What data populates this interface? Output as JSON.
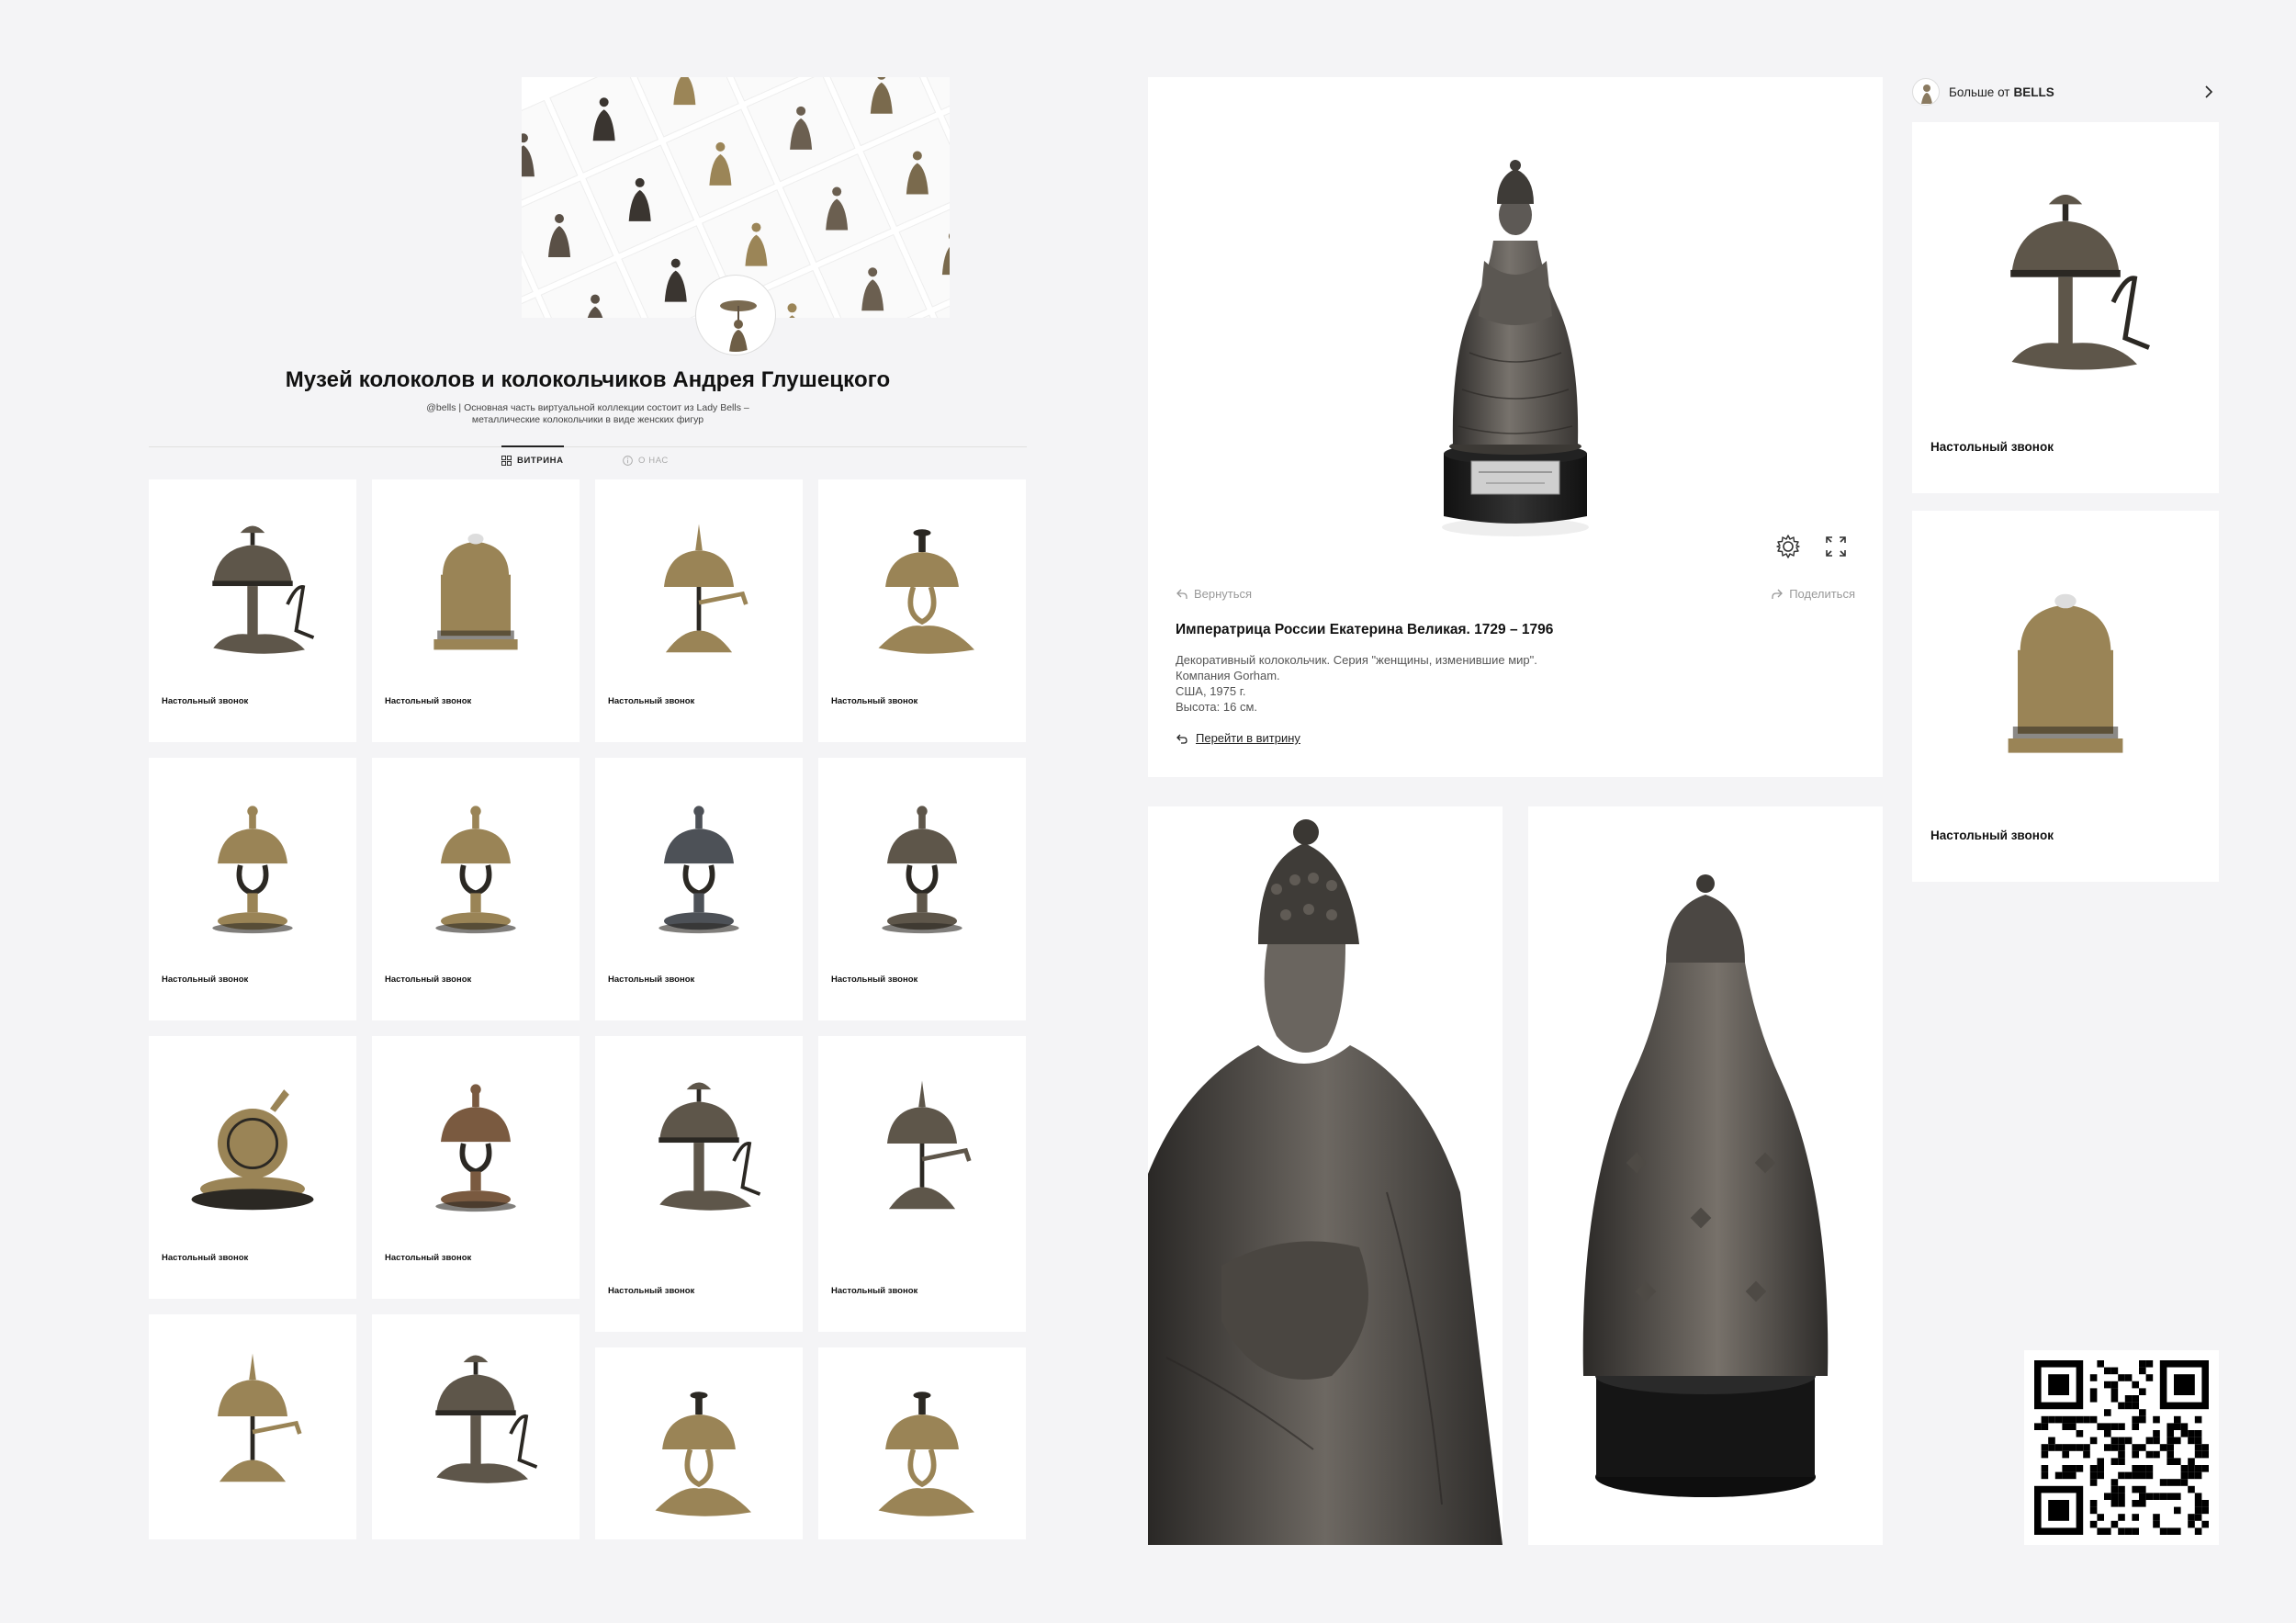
{
  "profile": {
    "title": "Музей колоколов и колокольчиков Андрея Глушецкого",
    "description": "@bells | Основная часть виртуальной коллекции состоит из Lady Bells – металлические колокольчики в виде женских фигур"
  },
  "tabs": [
    {
      "label": "ВИТРИНА",
      "active": true,
      "icon": "grid-icon"
    },
    {
      "label": "О НАС",
      "active": false,
      "icon": "info-icon"
    }
  ],
  "grid_items": [
    {
      "label": "Настольный звонок",
      "tone": "bronze"
    },
    {
      "label": "Настольный звонок",
      "tone": "brass"
    },
    {
      "label": "Настольный звонок",
      "tone": "brass"
    },
    {
      "label": "Настольный звонок",
      "tone": "brass"
    },
    {
      "label": "Настольный звонок",
      "tone": "brass"
    },
    {
      "label": "Настольный звонок",
      "tone": "brass"
    },
    {
      "label": "Настольный звонок",
      "tone": "steel"
    },
    {
      "label": "Настольный звонок",
      "tone": "bronze"
    },
    {
      "label": "Настольный звонок",
      "tone": "brass"
    },
    {
      "label": "Настольный звонок",
      "tone": "copper"
    },
    {
      "label": "Настольный звонок",
      "tone": "bronze"
    },
    {
      "label": "Настольный звонок",
      "tone": "bronze"
    },
    {
      "label": "",
      "tone": "brass"
    },
    {
      "label": "",
      "tone": "bronze"
    },
    {
      "label": "",
      "tone": "brass"
    },
    {
      "label": "",
      "tone": "brass"
    }
  ],
  "detail": {
    "back_label": "Вернуться",
    "share_label": "Поделиться",
    "title": "Императрица России Екатерина Великая. 1729 – 1796",
    "description_lines": [
      "Декоративный колокольчик. Серия \"женщины, изменившие мир\".",
      "Компания Gorham.",
      "США, 1975 г.",
      "Высота: 16 см."
    ],
    "showcase_link": "Перейти в витрину"
  },
  "more": {
    "prefix": "Больше от",
    "brand": "BELLS",
    "items": [
      {
        "label": "Настольный звонок"
      },
      {
        "label": "Настольный звонок"
      }
    ]
  },
  "colors": {
    "bronze": "#5e564a",
    "brass": "#9a8456",
    "steel": "#4d5157",
    "copper": "#7a5a40",
    "silver": "#55524f"
  }
}
